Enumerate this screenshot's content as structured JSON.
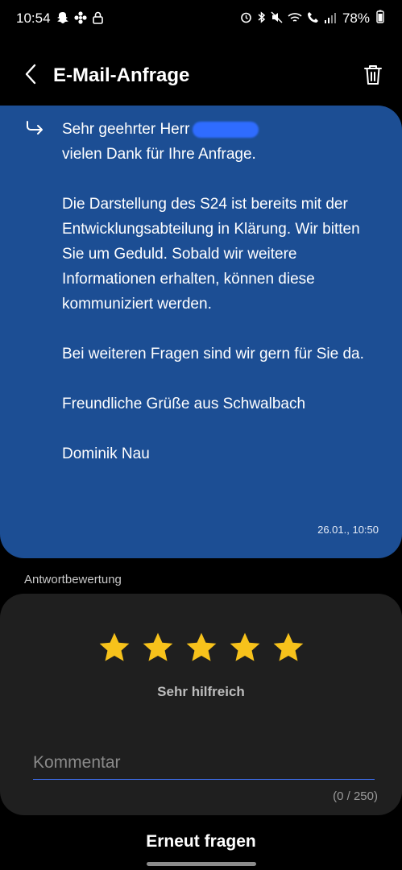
{
  "status_bar": {
    "time": "10:54",
    "battery": "78%",
    "left_icons": [
      "snapchat-icon",
      "fan-icon",
      "lock-icon"
    ],
    "right_icons": [
      "alarm-icon",
      "bluetooth-icon",
      "mute-icon",
      "wifi-icon",
      "call-icon",
      "signal-icon"
    ]
  },
  "header": {
    "title": "E-Mail-Anfrage",
    "back_icon": "chevron-left-icon",
    "delete_icon": "trash-icon"
  },
  "message": {
    "greeting": "Sehr geehrter Herr",
    "body": "vielen Dank für Ihre Anfrage.\n\nDie Darstellung des S24 ist bereits mit der Entwicklungsabteilung in Klärung. Wir bitten Sie um Geduld. Sobald wir weitere Informationen erhalten, können diese kommuniziert werden.\n\nBei weiteren Fragen sind wir gern für Sie da.\n\nFreundliche Grüße aus Schwalbach\n\nDominik Nau",
    "timestamp": "26.01., 10:50"
  },
  "rating": {
    "section_label": "Antwortbewertung",
    "stars": 5,
    "max_stars": 5,
    "star_color": "#f7c21b",
    "label": "Sehr hilfreich"
  },
  "comment": {
    "placeholder": "Kommentar",
    "value": "",
    "counter": "(0 / 250)"
  },
  "actions": {
    "ask_again": "Erneut fragen"
  },
  "colors": {
    "message_bg": "#1c4e94",
    "card_bg": "#1f1f1f",
    "accent_underline": "#3e6ff0"
  }
}
